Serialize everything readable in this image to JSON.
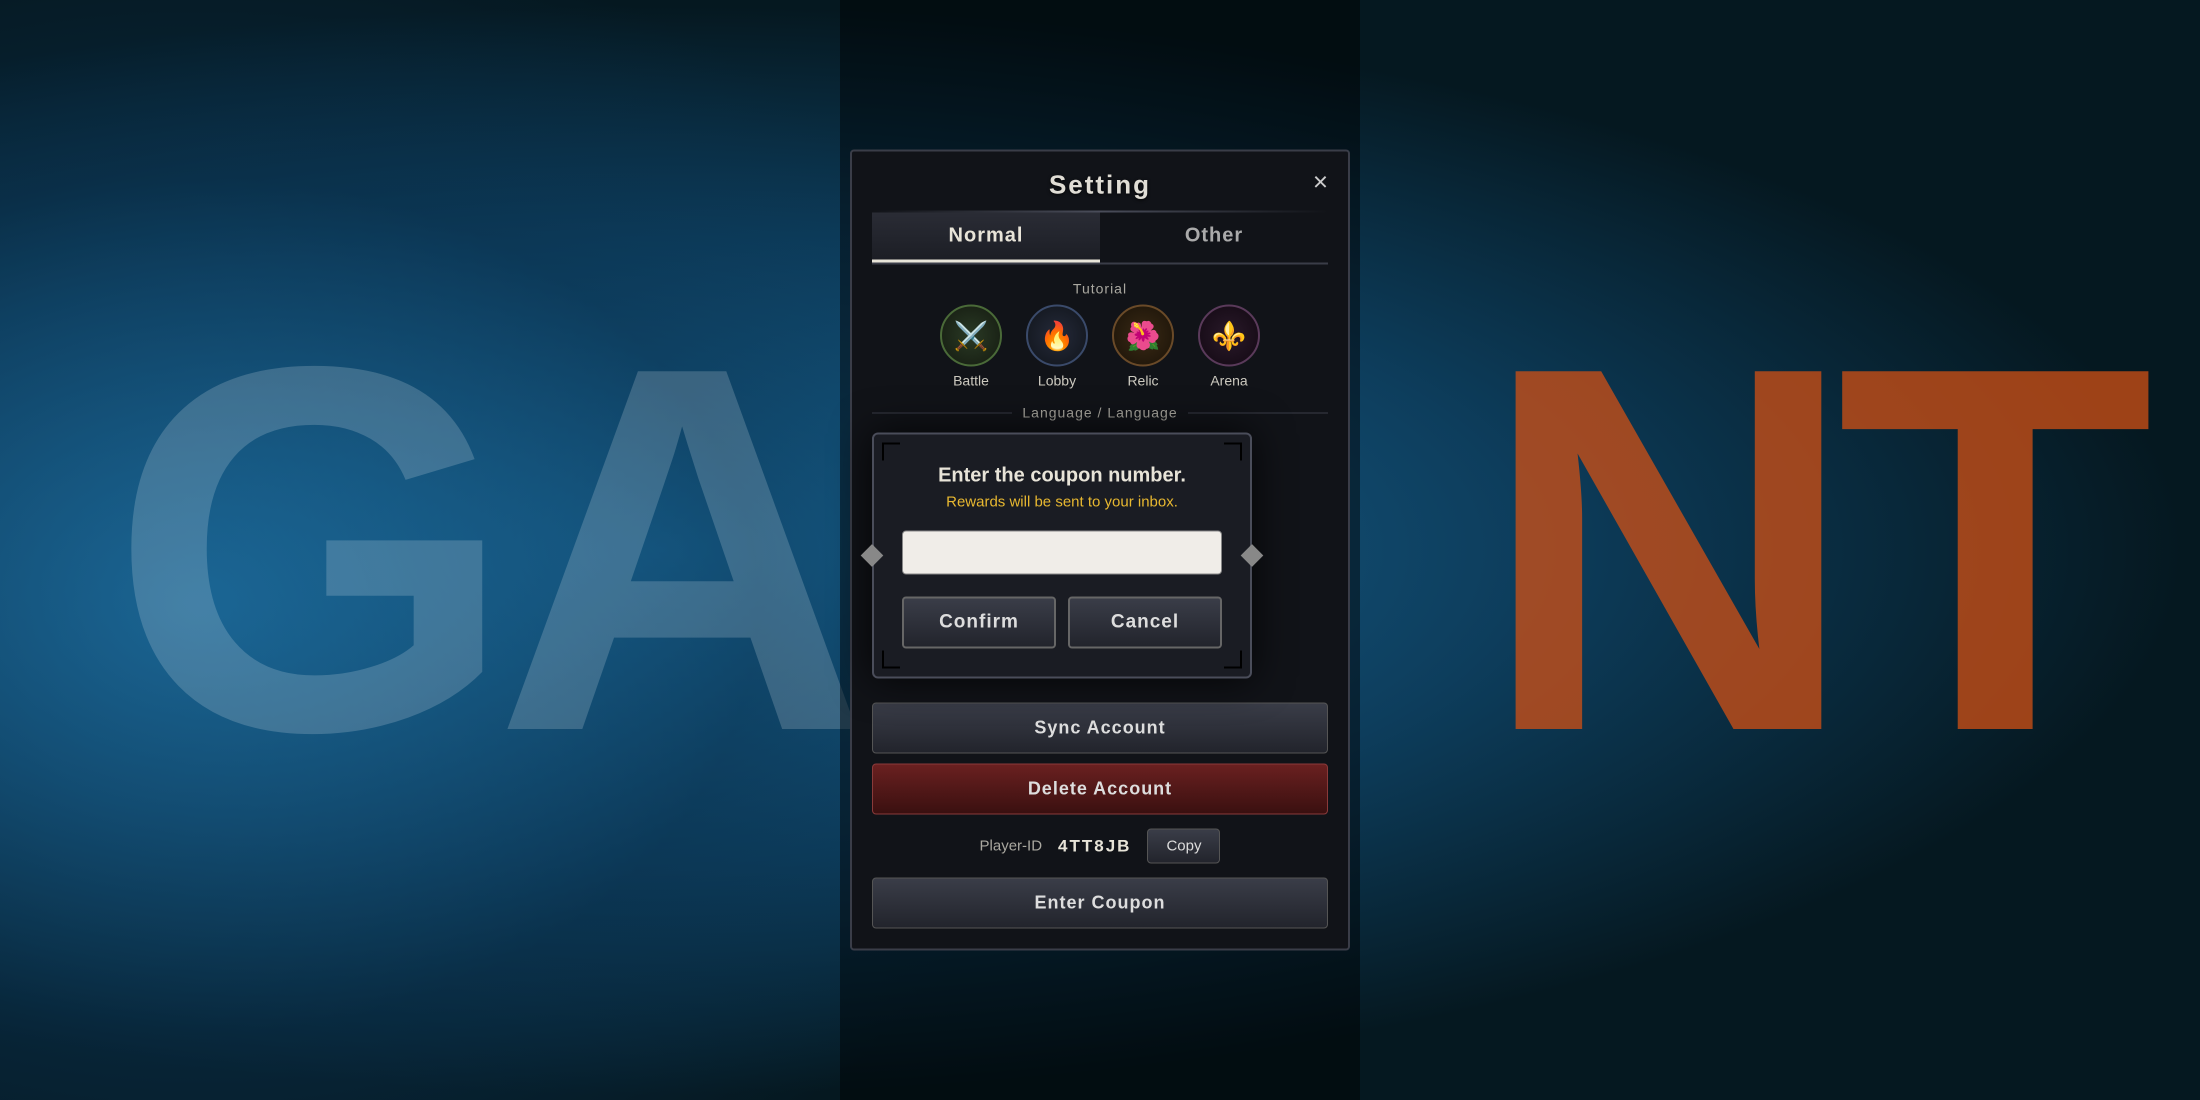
{
  "background": {
    "left_text": "GA",
    "right_text": "NT"
  },
  "setting": {
    "title": "Setting",
    "close_label": "×",
    "tabs": [
      {
        "id": "normal",
        "label": "Normal",
        "active": true
      },
      {
        "id": "other",
        "label": "Other",
        "active": false
      }
    ],
    "tutorial": {
      "section_label": "Tutorial",
      "items": [
        {
          "id": "battle",
          "label": "Battle",
          "icon": "⚔",
          "type": "battle"
        },
        {
          "id": "lobby",
          "label": "Lobby",
          "icon": "🔥",
          "type": "lobby"
        },
        {
          "id": "relic",
          "label": "Relic",
          "icon": "🌺",
          "type": "relic"
        },
        {
          "id": "arena",
          "label": "Arena",
          "icon": "⚜",
          "type": "arena"
        }
      ]
    },
    "language_label": "Language / Language",
    "sync_account_label": "Sync Account",
    "delete_account_label": "Delete Account",
    "player_id_label": "Player-ID",
    "player_id_value": "4TT8JB",
    "copy_label": "Copy",
    "enter_coupon_label": "Enter Coupon"
  },
  "dialog": {
    "prompt": "Enter the coupon number.",
    "sub_text": "Rewards will be sent to your inbox.",
    "input_placeholder": "",
    "confirm_label": "Confirm",
    "cancel_label": "Cancel"
  }
}
